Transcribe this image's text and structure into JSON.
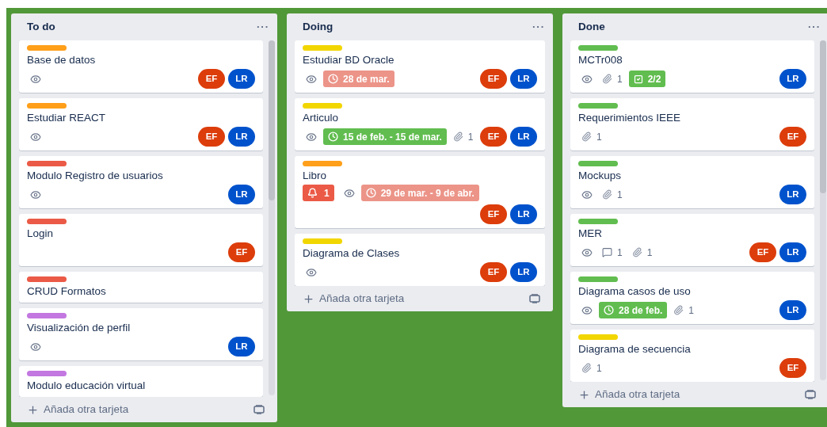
{
  "lists": [
    {
      "title": "To do",
      "menu": "···",
      "scrollbar": true,
      "add_card": "Añada otra tarjeta",
      "cards": [
        {
          "label": {
            "color": "#ff9f1a"
          },
          "title": "Base de datos",
          "badges": [
            {
              "kind": "watch"
            }
          ],
          "members": [
            {
              "initials": "EF",
              "color": "#dc3d0b"
            },
            {
              "initials": "LR",
              "color": "#0052cc"
            }
          ]
        },
        {
          "label": {
            "color": "#ff9f1a"
          },
          "title": "Estudiar REACT",
          "badges": [
            {
              "kind": "watch"
            }
          ],
          "members": [
            {
              "initials": "EF",
              "color": "#dc3d0b"
            },
            {
              "initials": "LR",
              "color": "#0052cc"
            }
          ]
        },
        {
          "label": {
            "color": "#eb5a46"
          },
          "title": "Modulo Registro de usuarios",
          "badges": [
            {
              "kind": "watch"
            }
          ],
          "members": [
            {
              "initials": "LR",
              "color": "#0052cc"
            }
          ]
        },
        {
          "label": {
            "color": "#eb5a46"
          },
          "title": "Login",
          "members": [
            {
              "initials": "EF",
              "color": "#dc3d0b"
            }
          ]
        },
        {
          "label": {
            "color": "#eb5a46"
          },
          "title": "CRUD Formatos"
        },
        {
          "label": {
            "color": "#c377e0"
          },
          "title": "Visualización de perfil",
          "badges": [
            {
              "kind": "watch"
            }
          ],
          "members": [
            {
              "initials": "LR",
              "color": "#0052cc"
            }
          ]
        },
        {
          "label": {
            "color": "#c377e0"
          },
          "title": "Modulo educación virtual"
        }
      ]
    },
    {
      "title": "Doing",
      "menu": "···",
      "scrollbar": false,
      "add_card": "Añada otra tarjeta",
      "cards": [
        {
          "label": {
            "color": "#f2d600"
          },
          "title": "Estudiar BD Oracle",
          "badges": [
            {
              "kind": "watch"
            },
            {
              "kind": "due",
              "text": "28 de mar.",
              "color": "#ec9488"
            }
          ],
          "members": [
            {
              "initials": "EF",
              "color": "#dc3d0b"
            },
            {
              "initials": "LR",
              "color": "#0052cc"
            }
          ]
        },
        {
          "label": {
            "color": "#f2d600"
          },
          "title": "Articulo",
          "badges": [
            {
              "kind": "watch"
            },
            {
              "kind": "due",
              "text": "15 de feb. - 15 de mar.",
              "color": "#61bd4f"
            },
            {
              "kind": "attachments",
              "text": "1"
            }
          ],
          "members": [
            {
              "initials": "EF",
              "color": "#dc3d0b"
            },
            {
              "initials": "LR",
              "color": "#0052cc"
            }
          ]
        },
        {
          "label": {
            "color": "#ff9f1a"
          },
          "title": "Libro",
          "badges": [
            {
              "kind": "notifications",
              "text": "1",
              "color": "#eb5a46"
            },
            {
              "kind": "watch"
            },
            {
              "kind": "due",
              "text": "29 de mar. - 9 de abr.",
              "color": "#ec9488"
            }
          ],
          "members": [
            {
              "initials": "EF",
              "color": "#dc3d0b"
            },
            {
              "initials": "LR",
              "color": "#0052cc"
            }
          ]
        },
        {
          "label": {
            "color": "#f2d600"
          },
          "title": "Diagrama de Clases",
          "badges": [
            {
              "kind": "watch"
            }
          ],
          "members": [
            {
              "initials": "EF",
              "color": "#dc3d0b"
            },
            {
              "initials": "LR",
              "color": "#0052cc"
            }
          ]
        }
      ]
    },
    {
      "title": "Done",
      "menu": "···",
      "scrollbar": true,
      "add_card": "Añada otra tarjeta",
      "cards": [
        {
          "label": {
            "color": "#61bd4f"
          },
          "title": "MCTr008",
          "badges": [
            {
              "kind": "watch"
            },
            {
              "kind": "attachments",
              "text": "1"
            },
            {
              "kind": "checklist",
              "text": "2/2",
              "color": "#61bd4f"
            }
          ],
          "members": [
            {
              "initials": "LR",
              "color": "#0052cc"
            }
          ]
        },
        {
          "label": {
            "color": "#61bd4f"
          },
          "title": "Requerimientos IEEE",
          "badges": [
            {
              "kind": "attachments",
              "text": "1"
            }
          ],
          "members": [
            {
              "initials": "EF",
              "color": "#dc3d0b"
            }
          ]
        },
        {
          "label": {
            "color": "#61bd4f"
          },
          "title": "Mockups",
          "badges": [
            {
              "kind": "watch"
            },
            {
              "kind": "attachments",
              "text": "1"
            }
          ],
          "members": [
            {
              "initials": "LR",
              "color": "#0052cc"
            }
          ]
        },
        {
          "label": {
            "color": "#61bd4f"
          },
          "title": "MER",
          "badges": [
            {
              "kind": "watch"
            },
            {
              "kind": "comments",
              "text": "1"
            },
            {
              "kind": "attachments",
              "text": "1"
            }
          ],
          "members": [
            {
              "initials": "EF",
              "color": "#dc3d0b"
            },
            {
              "initials": "LR",
              "color": "#0052cc"
            }
          ]
        },
        {
          "label": {
            "color": "#61bd4f"
          },
          "title": "Diagrama casos de uso",
          "badges": [
            {
              "kind": "watch"
            },
            {
              "kind": "due",
              "text": "28 de feb.",
              "color": "#61bd4f"
            },
            {
              "kind": "attachments",
              "text": "1"
            }
          ],
          "members": [
            {
              "initials": "LR",
              "color": "#0052cc"
            }
          ]
        },
        {
          "label": {
            "color": "#f2d600"
          },
          "title": "Diagrama de secuencia",
          "badges": [
            {
              "kind": "attachments",
              "text": "1"
            }
          ],
          "members": [
            {
              "initials": "EF",
              "color": "#dc3d0b"
            }
          ]
        }
      ]
    }
  ]
}
